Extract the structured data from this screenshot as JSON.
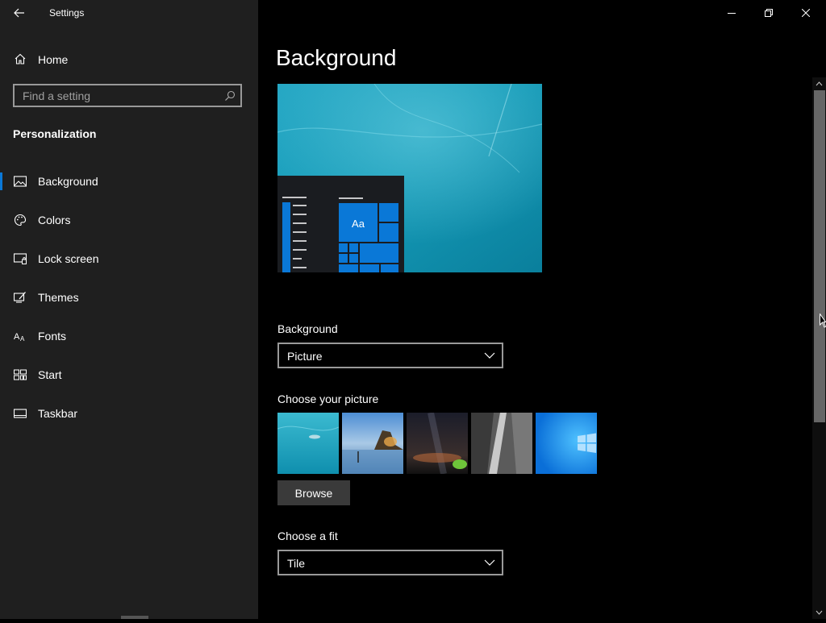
{
  "window": {
    "title": "Settings",
    "back_icon": "back-arrow-icon",
    "controls": {
      "minimize_icon": "minimize-icon",
      "restore_icon": "restore-icon",
      "close_icon": "close-icon"
    }
  },
  "sidebar": {
    "home_label": "Home",
    "home_icon": "home-icon",
    "search": {
      "placeholder": "Find a setting",
      "value": "",
      "icon": "search-icon"
    },
    "section_heading": "Personalization",
    "items": [
      {
        "label": "Background",
        "icon": "picture-icon",
        "active": true
      },
      {
        "label": "Colors",
        "icon": "palette-icon",
        "active": false
      },
      {
        "label": "Lock screen",
        "icon": "lock-screen-icon",
        "active": false
      },
      {
        "label": "Themes",
        "icon": "themes-icon",
        "active": false
      },
      {
        "label": "Fonts",
        "icon": "fonts-icon",
        "active": false
      },
      {
        "label": "Start",
        "icon": "start-icon",
        "active": false
      },
      {
        "label": "Taskbar",
        "icon": "taskbar-icon",
        "active": false
      }
    ],
    "accent_color": "#0a78d7"
  },
  "main": {
    "page_title": "Background",
    "preview": {
      "tile_label": "Aa"
    },
    "background_field": {
      "label": "Background",
      "value": "Picture"
    },
    "choose_picture": {
      "label": "Choose your picture",
      "thumbnails": [
        "underwater-swimmer",
        "beach-rocks-sunset",
        "night-sky-tent",
        "waterfall-cliff",
        "windows-default"
      ]
    },
    "browse_label": "Browse",
    "fit_field": {
      "label": "Choose a fit",
      "value": "Tile"
    }
  },
  "colors": {
    "sidebar_bg": "#1f1f1f",
    "main_bg": "#000000",
    "accent": "#0a78d7",
    "tile_blue": "#0a78d7"
  }
}
